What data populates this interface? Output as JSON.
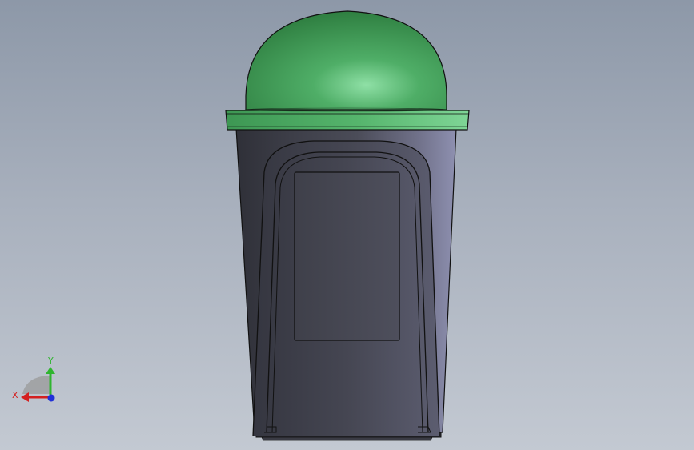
{
  "viewport": {
    "background_top": "#8d98a8",
    "background_bottom": "#c3c9d2"
  },
  "model": {
    "parts": [
      "dome-lid",
      "lid-rim",
      "bin-body",
      "handle-recess",
      "label-panel",
      "base"
    ],
    "lid_color": "#3f9a55",
    "body_color": "#4a4b57"
  },
  "triad": {
    "x_label": "X",
    "y_label": "Y",
    "x_color": "#d42020",
    "y_color": "#2fb52f",
    "z_color": "#2030d8"
  }
}
